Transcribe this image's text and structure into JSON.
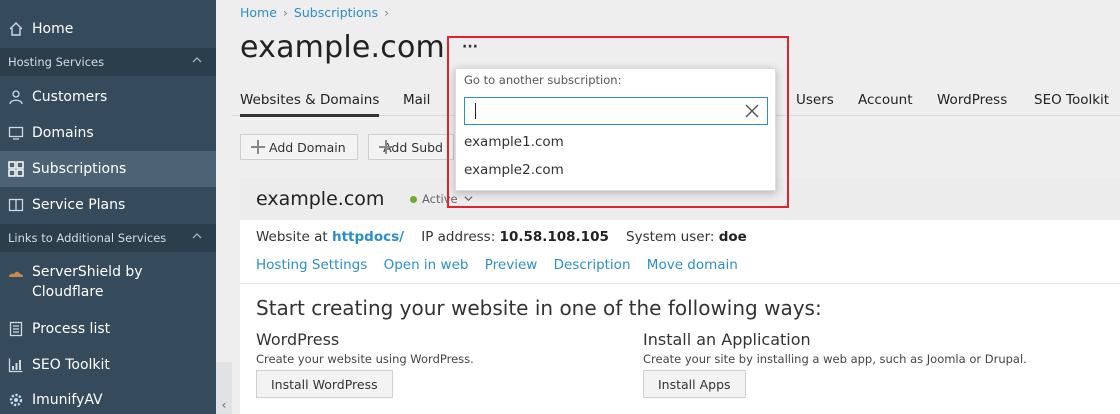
{
  "sidebar": {
    "items": [
      {
        "label": "Home",
        "icon": "home-icon"
      },
      {
        "label": "Customers",
        "icon": "user-icon"
      },
      {
        "label": "Domains",
        "icon": "monitor-icon"
      },
      {
        "label": "Subscriptions",
        "icon": "grid-icon"
      },
      {
        "label": "Service Plans",
        "icon": "book-icon"
      },
      {
        "label": "ServerShield by Cloudflare",
        "icon": "cloud-icon"
      },
      {
        "label": "Process list",
        "icon": "list-icon"
      },
      {
        "label": "SEO Toolkit",
        "icon": "chart-icon"
      },
      {
        "label": "ImunifyAV",
        "icon": "gear-icon"
      }
    ],
    "sections": [
      {
        "label": "Hosting Services"
      },
      {
        "label": "Links to Additional Services"
      }
    ],
    "active": "Subscriptions",
    "collapse_glyph": "‹"
  },
  "breadcrumb": {
    "home": "Home",
    "subscriptions": "Subscriptions"
  },
  "page": {
    "title": "example.com",
    "more": "···"
  },
  "tabs": [
    "Websites & Domains",
    "Mail",
    "Users",
    "Account",
    "WordPress",
    "SEO Toolkit"
  ],
  "toolbar": {
    "add_domain": "Add Domain",
    "add_subdomain": "Add Subd"
  },
  "card": {
    "domain": "example.com",
    "status": "Active",
    "website_at_label": "Website at",
    "website_link": "httpdocs/",
    "ip_label": "IP address:",
    "ip_value": "10.58.108.105",
    "sysuser_label": "System user:",
    "sysuser_value": "doe",
    "links": [
      "Hosting Settings",
      "Open in web",
      "Preview",
      "Description",
      "Move domain"
    ],
    "start_title": "Start creating your website in one of the following ways:",
    "wp_title": "WordPress",
    "wp_desc": "Create your website using WordPress.",
    "wp_button": "Install WordPress",
    "app_title": "Install an Application",
    "app_desc": "Create your site by installing a web app, such as Joomla or Drupal.",
    "app_button": "Install Apps"
  },
  "popup": {
    "title": "Go to another subscription:",
    "input_value": "",
    "options": [
      "example1.com",
      "example2.com"
    ]
  },
  "colors": {
    "sidebar": "#354a5a",
    "accent": "#2a8fc8",
    "highlight": "#e0242f",
    "status": "#6aad2a"
  }
}
